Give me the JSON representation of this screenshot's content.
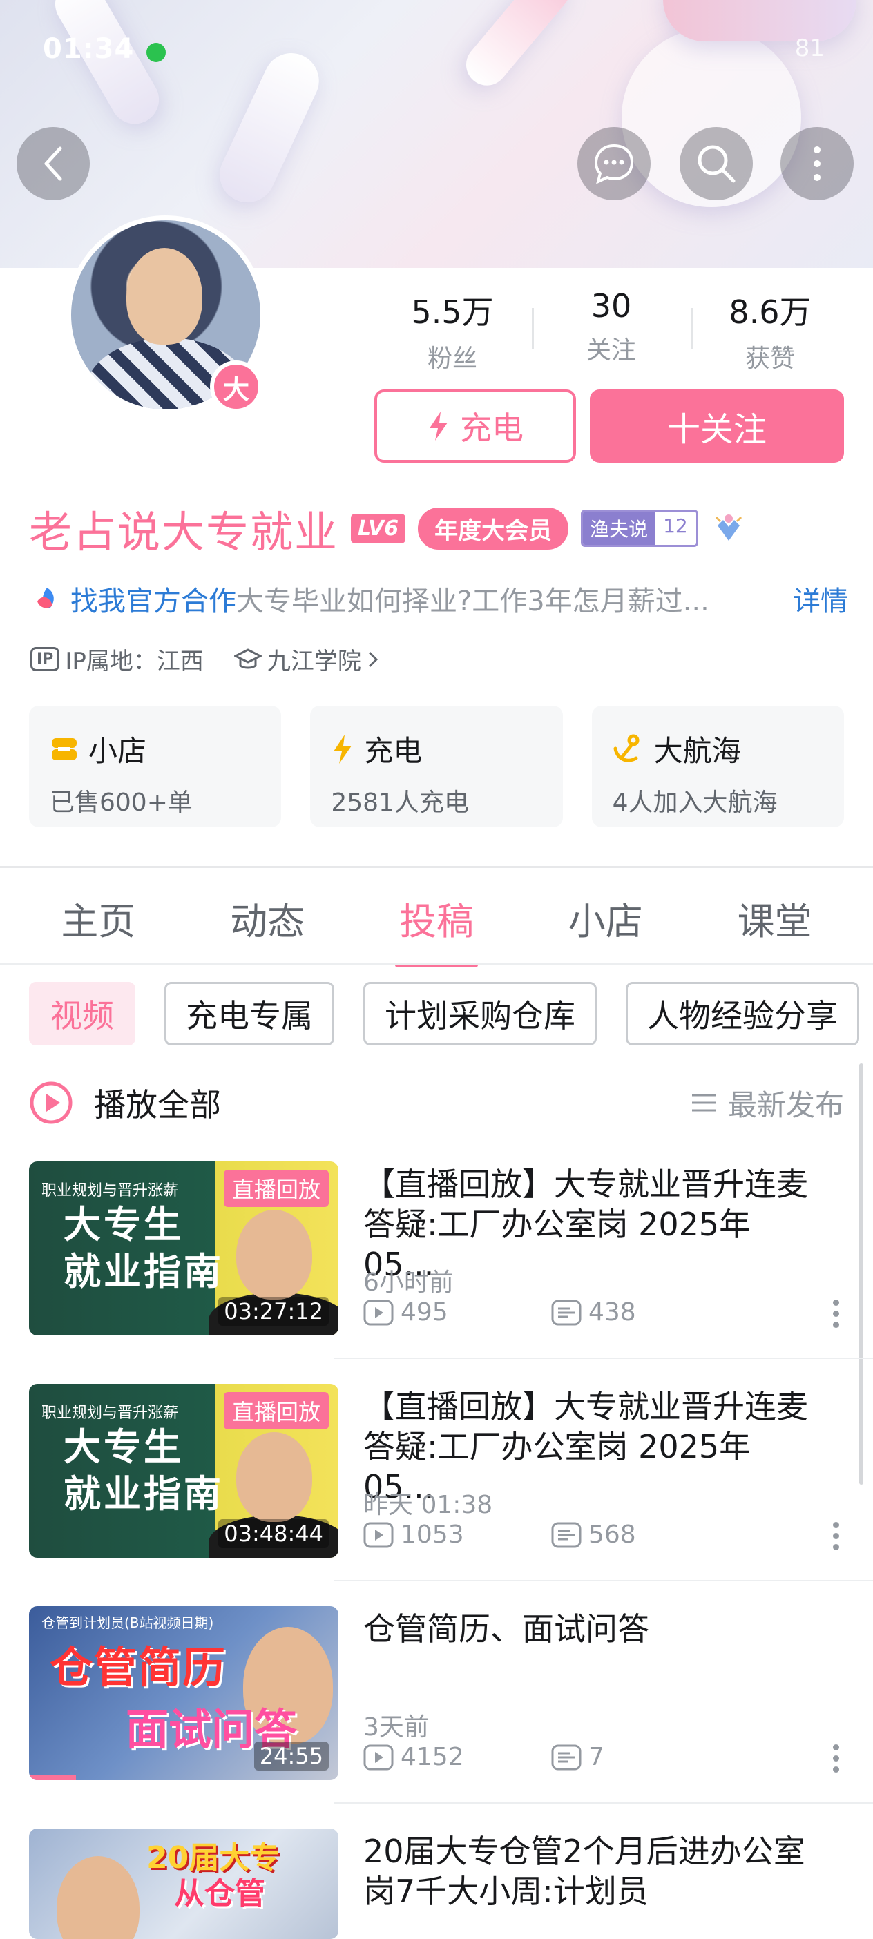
{
  "status": {
    "time": "01:34",
    "battery": "81"
  },
  "profile": {
    "avatar_badge": "大",
    "stats": [
      {
        "value": "5.5万",
        "label": "粉丝"
      },
      {
        "value": "30",
        "label": "关注"
      },
      {
        "value": "8.6万",
        "label": "获赞"
      }
    ],
    "charge_label": "充电",
    "follow_label": "十关注",
    "name": "老占说大专就业",
    "level": "LV6",
    "vip": "年度大会员",
    "medal_name": "渔夫说",
    "medal_level": "12",
    "bio_link": "找我官方合作",
    "bio_text": "大专毕业如何择业?工作3年怎月薪过...",
    "bio_detail": "详情",
    "ip_tag": "IP",
    "ip_location": "IP属地：江西",
    "school": "九江学院"
  },
  "cards": [
    {
      "title": "小店",
      "sub": "已售600+单",
      "icon": "shop-icon",
      "color": "#f7b500"
    },
    {
      "title": "充电",
      "sub": "2581人充电",
      "icon": "lightning-icon",
      "color": "#f7b500"
    },
    {
      "title": "大航海",
      "sub": "4人加入大航海",
      "icon": "anchor-icon",
      "color": "#f7b500"
    }
  ],
  "tabs": [
    "主页",
    "动态",
    "投稿",
    "小店",
    "课堂"
  ],
  "chips": [
    "视频",
    "充电专属",
    "计划采购仓库",
    "人物经验分享"
  ],
  "list_header": {
    "play_all": "播放全部",
    "sort": "最新发布"
  },
  "videos": [
    {
      "thumb_top": "职业规划与晋升涨薪",
      "thumb_line1": "大专生",
      "thumb_line2": "就业指南",
      "badge": "直播回放",
      "duration": "03:27:12",
      "title": "【直播回放】大专就业晋升连麦答疑:工厂办公室岗 2025年05...",
      "time": "6小时前",
      "views": "495",
      "comments": "438"
    },
    {
      "thumb_top": "职业规划与晋升涨薪",
      "thumb_line1": "大专生",
      "thumb_line2": "就业指南",
      "badge": "直播回放",
      "duration": "03:48:44",
      "title": "【直播回放】大专就业晋升连麦答疑:工厂办公室岗 2025年05...",
      "time": "昨天 01:38",
      "views": "1053",
      "comments": "568"
    },
    {
      "thumb_top": "仓管到计划员(B站视频日期)",
      "thumb_line1": "仓管简历",
      "thumb_line2": "面试问答",
      "duration": "24:55",
      "title": "仓管简历、面试问答",
      "time": "3天前",
      "views": "4152",
      "comments": "7"
    },
    {
      "thumb_line1": "20届大专",
      "thumb_line2": "从仓管",
      "title": "20届大专仓管2个月后进办公室岗7千大小周:计划员"
    }
  ],
  "colors": {
    "accent": "#fb7299",
    "link": "#2c7bd6",
    "muted": "#9499a0"
  }
}
